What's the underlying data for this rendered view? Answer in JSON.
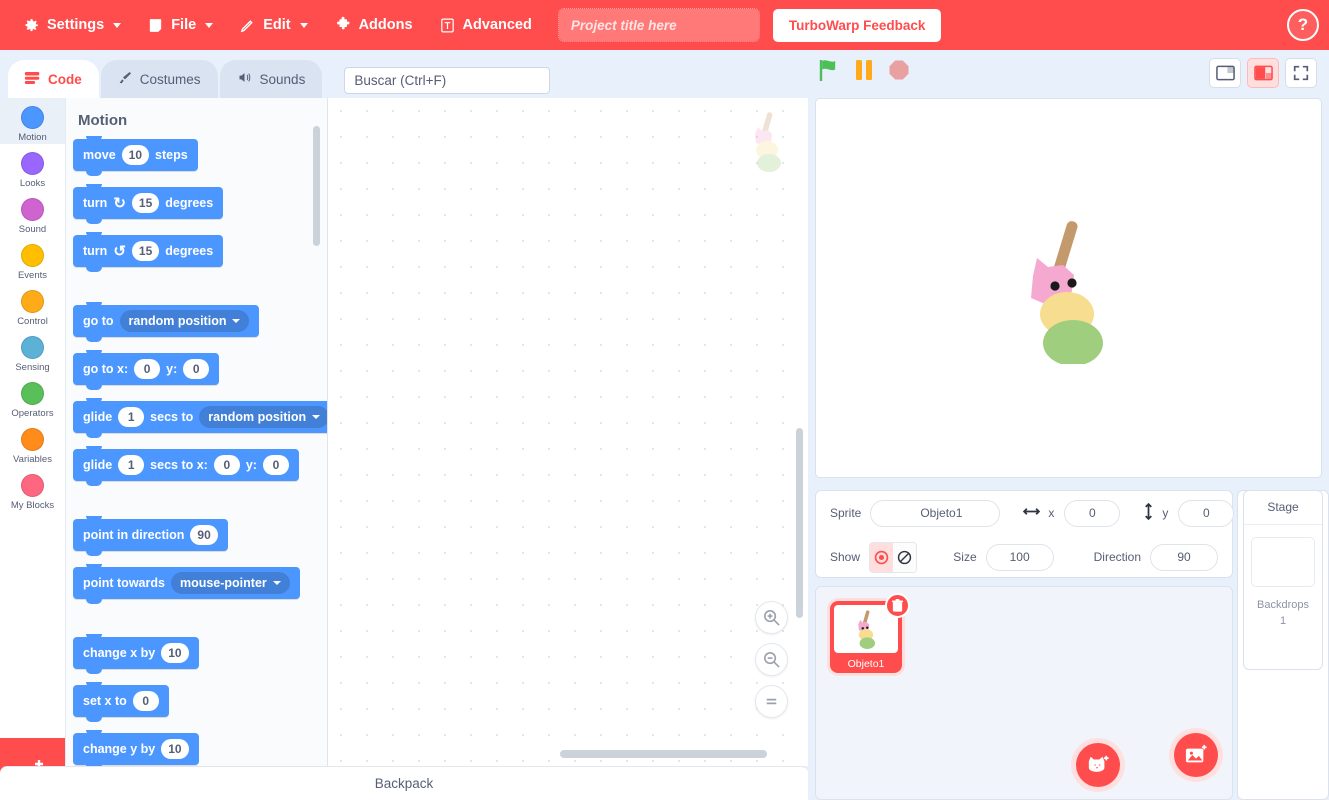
{
  "menu": {
    "items": [
      {
        "label": "Settings",
        "icon": "gear-icon",
        "caret": true,
        "name": "menu-settings"
      },
      {
        "label": "File",
        "icon": "file-icon",
        "caret": true,
        "name": "menu-file"
      },
      {
        "label": "Edit",
        "icon": "pencil-icon",
        "caret": true,
        "name": "menu-edit"
      },
      {
        "label": "Addons",
        "icon": "puzzle-icon",
        "caret": false,
        "name": "menu-addons"
      },
      {
        "label": "Advanced",
        "icon": "turbowarp-icon",
        "caret": false,
        "name": "menu-advanced"
      }
    ],
    "project_title_placeholder": "Project title here",
    "project_title_value": "",
    "feedback_label": "TurboWarp Feedback",
    "help_label": "?",
    "bar_color": "#ff4c4c"
  },
  "tabs": [
    {
      "label": "Code",
      "icon": "code-blocks-icon",
      "active": true,
      "name": "tab-code"
    },
    {
      "label": "Costumes",
      "icon": "paintbrush-icon",
      "active": false,
      "name": "tab-costumes"
    },
    {
      "label": "Sounds",
      "icon": "speaker-icon",
      "active": false,
      "name": "tab-sounds"
    }
  ],
  "search": {
    "placeholder": "Buscar (Ctrl+F)",
    "value": ""
  },
  "stage_controls": [
    {
      "name": "green-flag-icon",
      "label": "Go",
      "color": "#4cbf56"
    },
    {
      "name": "pause-icon",
      "label": "Pause",
      "color": "#ffab19"
    },
    {
      "name": "stop-icon",
      "label": "Stop",
      "color": "#e8a0a0"
    }
  ],
  "layout_controls": [
    {
      "name": "small-stage-button",
      "active": false
    },
    {
      "name": "large-stage-button",
      "active": true
    },
    {
      "name": "fullscreen-button",
      "active": false
    }
  ],
  "categories": [
    {
      "label": "Motion",
      "color": "#4c97ff",
      "selected": true
    },
    {
      "label": "Looks",
      "color": "#9966ff",
      "selected": false
    },
    {
      "label": "Sound",
      "color": "#cf63cf",
      "selected": false
    },
    {
      "label": "Events",
      "color": "#ffbf00",
      "selected": false
    },
    {
      "label": "Control",
      "color": "#ffab19",
      "selected": false
    },
    {
      "label": "Sensing",
      "color": "#5cb1d6",
      "selected": false
    },
    {
      "label": "Operators",
      "color": "#59c059",
      "selected": false
    },
    {
      "label": "Variables",
      "color": "#ff8c1a",
      "selected": false
    },
    {
      "label": "My Blocks",
      "color": "#ff6680",
      "selected": false
    }
  ],
  "palette": {
    "heading": "Motion",
    "blocks": [
      {
        "type": "block",
        "parts": [
          {
            "k": "t",
            "v": "move"
          },
          {
            "k": "n",
            "v": "10"
          },
          {
            "k": "t",
            "v": "steps"
          }
        ]
      },
      {
        "type": "block",
        "parts": [
          {
            "k": "t",
            "v": "turn"
          },
          {
            "k": "r",
            "v": "↻"
          },
          {
            "k": "n",
            "v": "15"
          },
          {
            "k": "t",
            "v": "degrees"
          }
        ]
      },
      {
        "type": "block",
        "parts": [
          {
            "k": "t",
            "v": "turn"
          },
          {
            "k": "r",
            "v": "↺"
          },
          {
            "k": "n",
            "v": "15"
          },
          {
            "k": "t",
            "v": "degrees"
          }
        ]
      },
      {
        "type": "gap"
      },
      {
        "type": "block",
        "parts": [
          {
            "k": "t",
            "v": "go to"
          },
          {
            "k": "d",
            "v": "random position"
          }
        ]
      },
      {
        "type": "block",
        "parts": [
          {
            "k": "t",
            "v": "go to x:"
          },
          {
            "k": "n",
            "v": "0"
          },
          {
            "k": "t",
            "v": "y:"
          },
          {
            "k": "n",
            "v": "0"
          }
        ]
      },
      {
        "type": "block",
        "parts": [
          {
            "k": "t",
            "v": "glide"
          },
          {
            "k": "n",
            "v": "1"
          },
          {
            "k": "t",
            "v": "secs to"
          },
          {
            "k": "d",
            "v": "random position"
          }
        ]
      },
      {
        "type": "block",
        "parts": [
          {
            "k": "t",
            "v": "glide"
          },
          {
            "k": "n",
            "v": "1"
          },
          {
            "k": "t",
            "v": "secs to x:"
          },
          {
            "k": "n",
            "v": "0"
          },
          {
            "k": "t",
            "v": "y:"
          },
          {
            "k": "n",
            "v": "0"
          }
        ]
      },
      {
        "type": "gap"
      },
      {
        "type": "block",
        "parts": [
          {
            "k": "t",
            "v": "point in direction"
          },
          {
            "k": "n",
            "v": "90"
          }
        ]
      },
      {
        "type": "block",
        "parts": [
          {
            "k": "t",
            "v": "point towards"
          },
          {
            "k": "d",
            "v": "mouse-pointer"
          }
        ]
      },
      {
        "type": "gap"
      },
      {
        "type": "block",
        "parts": [
          {
            "k": "t",
            "v": "change x by"
          },
          {
            "k": "n",
            "v": "10"
          }
        ]
      },
      {
        "type": "block",
        "parts": [
          {
            "k": "t",
            "v": "set x to"
          },
          {
            "k": "n",
            "v": "0"
          }
        ]
      },
      {
        "type": "block",
        "parts": [
          {
            "k": "t",
            "v": "change y by"
          },
          {
            "k": "n",
            "v": "10"
          }
        ]
      }
    ],
    "block_color": "#4c97ff"
  },
  "canvas": {
    "zoom_buttons": [
      {
        "name": "zoom-in-button",
        "glyph": "+"
      },
      {
        "name": "zoom-out-button",
        "glyph": "−"
      },
      {
        "name": "zoom-reset-button",
        "glyph": "="
      }
    ]
  },
  "backpack": {
    "label": "Backpack"
  },
  "sprite_info": {
    "sprite_label": "Sprite",
    "sprite_name": "Objeto1",
    "x_label": "x",
    "x_value": "0",
    "y_label": "y",
    "y_value": "0",
    "show_label": "Show",
    "show_visible": true,
    "size_label": "Size",
    "size_value": "100",
    "direction_label": "Direction",
    "direction_value": "90"
  },
  "stage_selector": {
    "title": "Stage",
    "backdrops_label": "Backdrops",
    "backdrops_count": "1"
  },
  "sprites": [
    {
      "name": "Objeto1",
      "selected": true
    }
  ],
  "fabs": [
    {
      "name": "add-sprite-button",
      "icon": "cat-face-plus-icon"
    },
    {
      "name": "add-backdrop-button",
      "icon": "image-plus-icon"
    }
  ]
}
